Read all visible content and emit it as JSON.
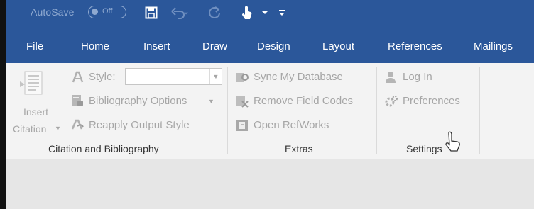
{
  "quick_access": {
    "autosave_label": "AutoSave",
    "autosave_state": "Off",
    "icons": [
      "save-icon",
      "undo-icon",
      "redo-icon",
      "touch-mode-icon",
      "dropdown-icon",
      "customize-icon"
    ]
  },
  "tabs": [
    {
      "label": "File"
    },
    {
      "label": "Home"
    },
    {
      "label": "Insert"
    },
    {
      "label": "Draw"
    },
    {
      "label": "Design"
    },
    {
      "label": "Layout"
    },
    {
      "label": "References"
    },
    {
      "label": "Mailings"
    }
  ],
  "ribbon": {
    "citation_group": {
      "insert_citation_line1": "Insert",
      "insert_citation_line2": "Citation",
      "style_label": "Style:",
      "style_value": "",
      "bibliography_options": "Bibliography Options",
      "reapply_output_style": "Reapply Output Style",
      "group_label": "Citation and Bibliography"
    },
    "extras_group": {
      "sync_my_database": "Sync My Database",
      "remove_field_codes": "Remove Field Codes",
      "open_refworks": "Open RefWorks",
      "group_label": "Extras"
    },
    "settings_group": {
      "log_in": "Log In",
      "preferences": "Preferences",
      "group_label": "Settings"
    }
  },
  "colors": {
    "title_bar": "#2b579a",
    "ribbon_bg": "#f3f3f3",
    "disabled_text": "#a6a6a6",
    "group_label_text": "#333333",
    "document_bg": "#e6e6e6"
  }
}
